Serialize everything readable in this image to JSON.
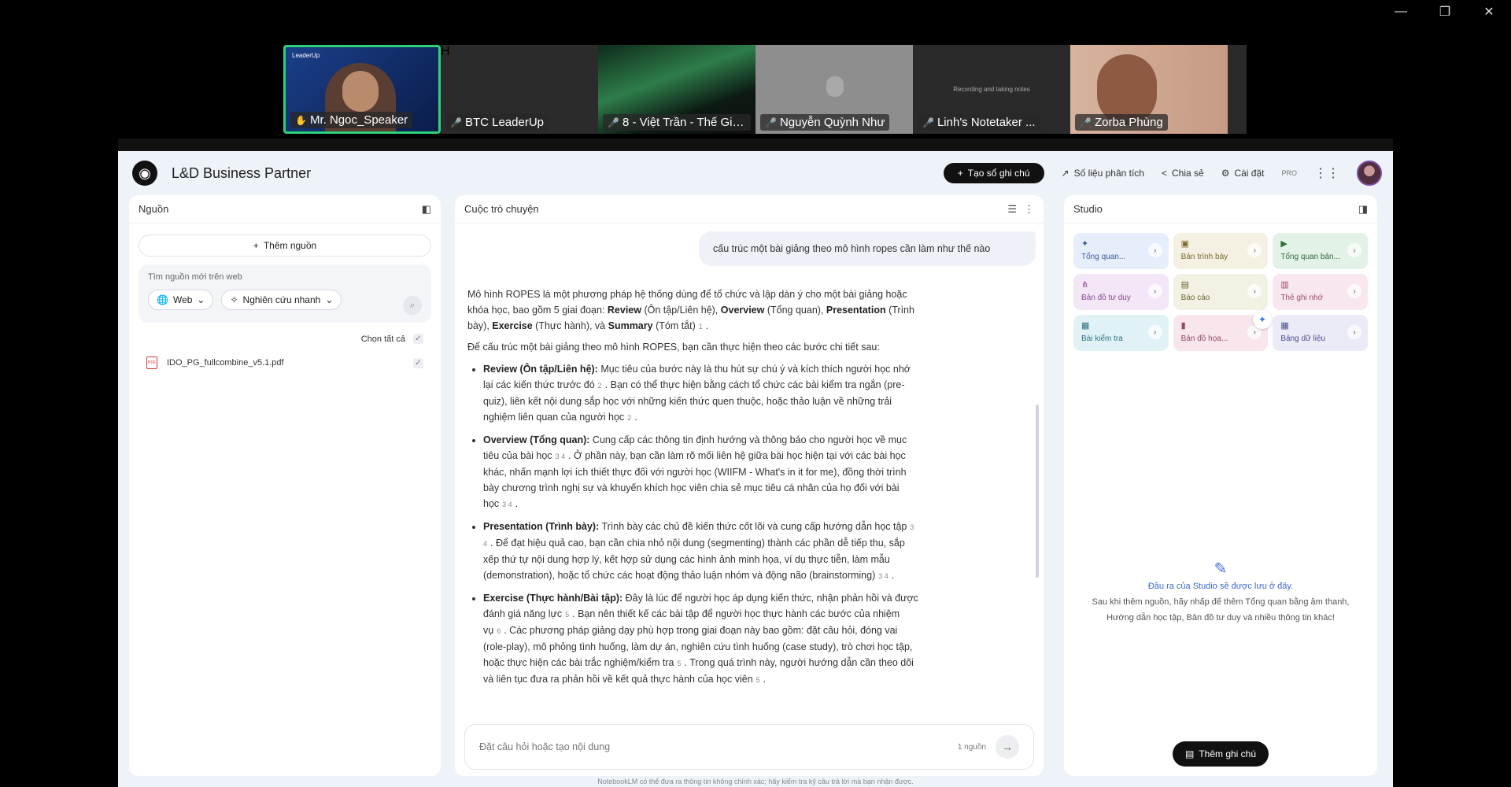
{
  "window": {
    "min": "—",
    "restore": "❐",
    "close": "✕"
  },
  "meeting": {
    "participants": [
      {
        "name": "Mr. Ngoc_Speaker",
        "style": "speaker",
        "active": true,
        "badge": "LeaderUp"
      },
      {
        "name": "BTC LeaderUp",
        "style": "letter",
        "letter": "H"
      },
      {
        "name": "8 - Việt Trần - Thế Giới...",
        "style": "aurora"
      },
      {
        "name": "Nguyễn Quỳnh Như",
        "style": "gray"
      },
      {
        "name": "Linh's Notetaker ...",
        "style": "dark",
        "note": "Recording and taking notes"
      },
      {
        "name": "Zorba Phùng",
        "style": "face"
      }
    ]
  },
  "app": {
    "title": "L&D Business Partner",
    "create_label": "Tạo sổ ghi chú",
    "analytics_label": "Số liệu phân tích",
    "share_label": "Chia sẻ",
    "settings_label": "Cài đặt",
    "pro_label": "PRO"
  },
  "sources": {
    "header": "Nguồn",
    "add_label": "Thêm nguồn",
    "web_placeholder": "Tìm nguồn mới trên web",
    "web_option": "Web",
    "research_option": "Nghiên cứu nhanh",
    "select_all": "Chọn tất cả",
    "files": [
      {
        "name": "IDO_PG_fullcombine_v5.1.pdf",
        "checked": true
      }
    ]
  },
  "chat": {
    "header": "Cuộc trò chuyện",
    "user_message": "cấu trúc một bài giảng theo mô hình ropes cần làm như thế nào",
    "intro_plain": "Mô hình ROPES là một phương pháp hệ thống dùng để tổ chức và lập dàn ý cho một bài giảng hoặc khóa học, bao gồm 5 giai đoạn: ",
    "intro_terms": [
      {
        "term": "Review",
        "gloss": " (Ôn tập/Liên hệ), "
      },
      {
        "term": "Overview",
        "gloss": " (Tổng quan), "
      },
      {
        "term": "Presentation",
        "gloss": " (Trình bày), "
      },
      {
        "term": "Exercise",
        "gloss": " (Thực hành), và "
      },
      {
        "term": "Summary",
        "gloss": " (Tóm tắt)"
      }
    ],
    "intro_cite": "1",
    "lead": "Để cấu trúc một bài giảng theo mô hình ROPES, bạn cần thực hiện theo các bước chi tiết sau:",
    "steps": [
      {
        "title": "Review (Ôn tập/Liên hệ):",
        "parts": [
          {
            "t": " Mục tiêu của bước này là thu hút sự chú ý và kích thích người học nhớ lại các kiến thức trước đó",
            "c": "2"
          },
          {
            "t": ". Bạn có thể thực hiện bằng cách tổ chức các bài kiểm tra ngắn (pre-quiz), liên kết nội dung sắp học với những kiến thức quen thuộc, hoặc thảo luận về những trải nghiệm liên quan của người học",
            "c": "2"
          },
          {
            "t": ".",
            "c": ""
          }
        ]
      },
      {
        "title": "Overview (Tổng quan):",
        "parts": [
          {
            "t": " Cung cấp các thông tin định hướng và thông báo cho người học về mục tiêu của bài học",
            "c": "3  4"
          },
          {
            "t": ". Ở phần này, bạn cần làm rõ mối liên hệ giữa bài học hiện tại với các bài học khác, nhấn mạnh lợi ích thiết thực đối với người học (WIIFM - What's in it for me), đồng thời trình bày chương trình nghị sự và khuyến khích học viên chia sẻ mục tiêu cá nhân của họ đối với bài học",
            "c": "3  4"
          },
          {
            "t": ".",
            "c": ""
          }
        ]
      },
      {
        "title": "Presentation (Trình bày):",
        "parts": [
          {
            "t": " Trình bày các chủ đề kiến thức cốt lõi và cung cấp hướng dẫn học tập",
            "c": "3  4"
          },
          {
            "t": ". Để đạt hiệu quả cao, bạn cần chia nhỏ nội dung (segmenting) thành các phần dễ tiếp thu, sắp xếp thứ tự nội dung hợp lý, kết hợp sử dụng các hình ảnh minh họa, ví dụ thực tiễn, làm mẫu (demonstration), hoặc tổ chức các hoạt động thảo luận nhóm và động não (brainstorming)",
            "c": "3  4"
          },
          {
            "t": ".",
            "c": ""
          }
        ]
      },
      {
        "title": "Exercise (Thực hành/Bài tập):",
        "parts": [
          {
            "t": " Đây là lúc để người học áp dụng kiến thức, nhận phản hồi và được đánh giá năng lực",
            "c": "5"
          },
          {
            "t": ". Bạn nên thiết kế các bài tập để người học thực hành các bước của nhiệm vụ",
            "c": "6"
          },
          {
            "t": ". Các phương pháp giảng dạy phù hợp trong giai đoạn này bao gồm: đặt câu hỏi, đóng vai (role-play), mô phỏng tình huống, làm dự án, nghiên cứu tình huống (case study), trò chơi học tập, hoặc thực hiện các bài trắc nghiệm/kiểm tra",
            "c": "5"
          },
          {
            "t": ". Trong quá trình này, người hướng dẫn cần theo dõi và liên tục đưa ra phản hồi về kết quả thực hành của học viên",
            "c": "5"
          },
          {
            "t": ".",
            "c": ""
          }
        ]
      }
    ],
    "input_placeholder": "Đặt câu hỏi hoặc tạo nội dung",
    "source_count": "1 nguồn",
    "disclaimer": "NotebookLM có thể đưa ra thông tin không chính xác; hãy kiểm tra kỹ câu trả lời mà bạn nhận được."
  },
  "studio": {
    "header": "Studio",
    "tiles": [
      {
        "label": "Tổng quan...",
        "icon": "audio-icon",
        "color": "c-blue"
      },
      {
        "label": "Bản trình bày",
        "icon": "slides-icon",
        "color": "c-yellow"
      },
      {
        "label": "Tổng quan bản...",
        "icon": "video-icon",
        "color": "c-green"
      },
      {
        "label": "Bản đồ tư duy",
        "icon": "mindmap-icon",
        "color": "c-purple"
      },
      {
        "label": "Báo cáo",
        "icon": "report-icon",
        "color": "c-olive"
      },
      {
        "label": "Thẻ ghi nhớ",
        "icon": "flashcard-icon",
        "color": "c-pink"
      },
      {
        "label": "Bài kiểm tra",
        "icon": "quiz-icon",
        "color": "c-cyan"
      },
      {
        "label": "Bản đồ họa...",
        "icon": "infographic-icon",
        "color": "c-rose"
      },
      {
        "label": "Bảng dữ liệu",
        "icon": "table-icon",
        "color": "c-lilac"
      }
    ],
    "empty_title": "Đầu ra của Studio sẽ được lưu ở đây.",
    "empty_line1": "Sau khi thêm nguồn, hãy nhấp để thêm Tổng quan bằng âm thanh,",
    "empty_line2": "Hướng dẫn học tập, Bản đồ tư duy và nhiều thông tin khác!",
    "add_note_label": "Thêm ghi chú"
  }
}
